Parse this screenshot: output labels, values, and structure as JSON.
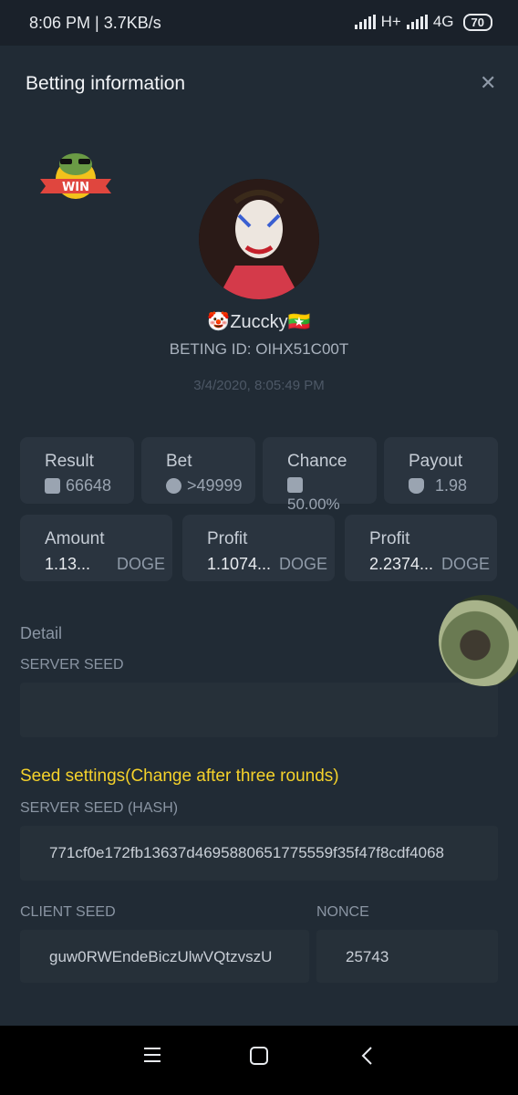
{
  "status_bar": {
    "time_speed": "8:06 PM | 3.7KB/s",
    "network1": "H+",
    "network2": "4G",
    "battery": "70"
  },
  "header": {
    "title": "Betting information",
    "close_icon": "close-icon"
  },
  "badge": {
    "text": "WIN"
  },
  "user": {
    "name": "🤡Zuccky🇲🇲",
    "bet_id": "BETING ID: OIHX51C00T",
    "datetime": "3/4/2020, 8:05:49 PM"
  },
  "stats": {
    "result": {
      "label": "Result",
      "value": "66648",
      "icon": "chart-icon"
    },
    "bet": {
      "label": "Bet",
      "value": ">49999",
      "icon": "bitcoin-icon"
    },
    "chance": {
      "label": "Chance",
      "value": "50.00%",
      "icon": "chart-icon"
    },
    "payout": {
      "label": "Payout",
      "value": "1.98",
      "icon": "payout-icon"
    }
  },
  "amounts": [
    {
      "label": "Amount",
      "value": "1.13...",
      "unit": "DOGE"
    },
    {
      "label": "Profit",
      "value": "1.1074...",
      "unit": "DOGE"
    },
    {
      "label": "Profit",
      "value": "2.2374...",
      "unit": "DOGE"
    }
  ],
  "detail": {
    "title": "Detail",
    "server_seed_label": "SERVER SEED",
    "server_seed_value": ""
  },
  "seed_settings": {
    "title": "Seed settings(Change after three rounds)",
    "server_seed_hash_label": "SERVER SEED (HASH)",
    "server_seed_hash": "771cf0e172fb13637d4695880651775559f35f47f8cdf4068",
    "client_seed_label": "CLIENT SEED",
    "client_seed": "guw0RWEndeBiczUlwVQtzvszU",
    "nonce_label": "NONCE",
    "nonce": "25743"
  },
  "nav": {
    "menu_icon": "menu-icon",
    "home_icon": "home-icon",
    "back_icon": "back-icon"
  }
}
